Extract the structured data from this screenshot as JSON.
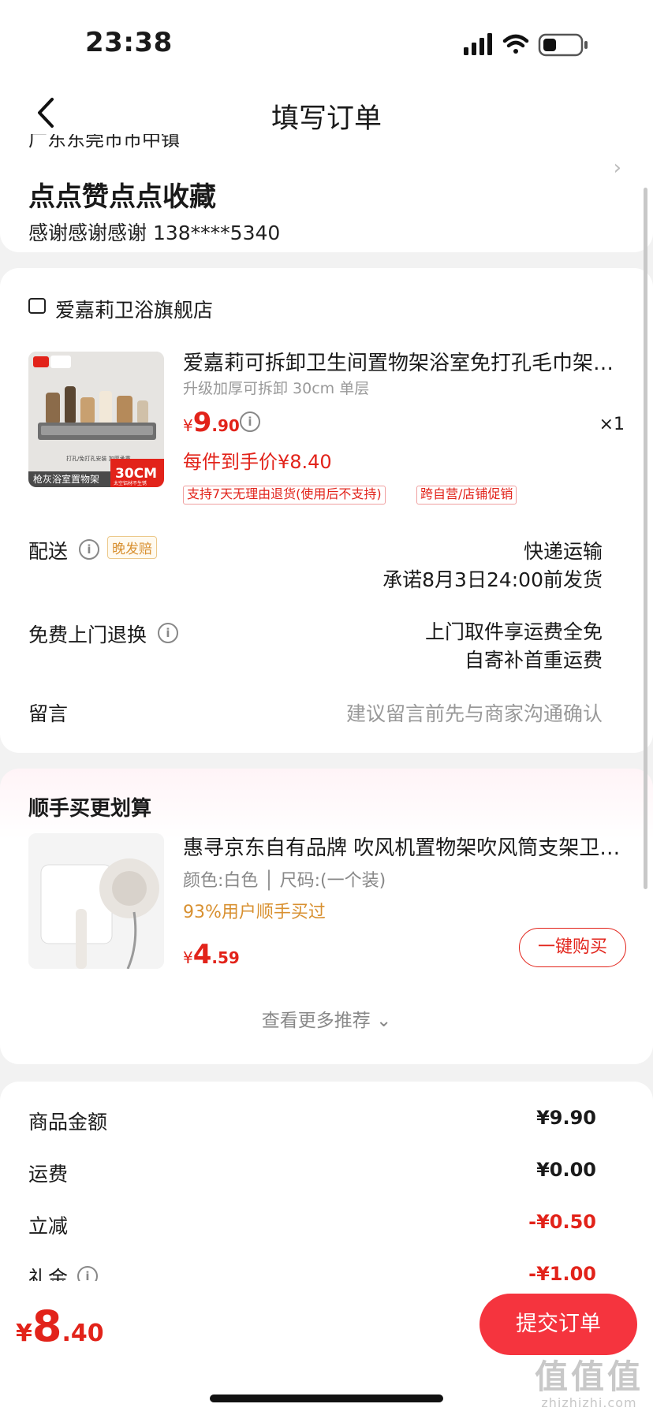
{
  "status": {
    "time": "23:38"
  },
  "nav": {
    "title": "填写订单"
  },
  "address": {
    "region": "广东东莞市市中镇",
    "name": "点点赞点点收藏",
    "contact": "感谢感谢感谢  138****5340",
    "arrow": "›"
  },
  "shop": {
    "name": "爱嘉莉卫浴旗舰店"
  },
  "product": {
    "title": "爱嘉莉可拆卸卫生间置物架浴室免打孔毛巾架厕所",
    "sku": "升级加厚可拆卸 30cm 单层",
    "price": {
      "currency": "¥",
      "int": "9",
      "dec": ".90"
    },
    "qty": "×1",
    "final_price": "每件到手价¥8.40",
    "tags": [
      "支持7天无理由退货(使用后不支持)",
      "跨自营/店铺促销"
    ],
    "image_text": {
      "top": "打孔/免打孔安装 加厚承重",
      "badge": "30CM",
      "badge_sub": "太空铝材不生锈",
      "bottom": "枪灰浴室置物架"
    }
  },
  "delivery": {
    "label": "配送",
    "badge": "晚发赔",
    "method": "快递运输",
    "promise": "承诺8月3日24:00前发货"
  },
  "return_service": {
    "label": "免费上门退换",
    "line1": "上门取件享运费全免",
    "line2": "自寄补首重运费"
  },
  "message": {
    "label": "留言",
    "placeholder": "建议留言前先与商家沟通确认"
  },
  "recommend": {
    "title": "顺手买更划算",
    "item": {
      "name": "惠寻京东自有品牌 吹风机置物架吹风筒支架卫生间",
      "spec": "颜色:白色 │ 尺码:(一个装)",
      "social": "93%用户顺手买过",
      "price": {
        "currency": "¥",
        "int": "4",
        "dec": ".59"
      },
      "button": "一键购买"
    },
    "more": "查看更多推荐 ⌄"
  },
  "summary": {
    "rows": [
      {
        "label": "商品金额",
        "value": "¥9.90"
      },
      {
        "label": "运费",
        "value": "¥0.00"
      },
      {
        "label": "立减",
        "value": "-¥0.50"
      },
      {
        "label": "礼金",
        "value": "-¥1.00"
      }
    ]
  },
  "bottom": {
    "total": {
      "currency": "¥",
      "int": "8",
      "dec": ".40"
    },
    "submit": "提交订单"
  },
  "watermark": {
    "main": "值值值",
    "sub": "zhizhizhi.com"
  },
  "colors": {
    "accent": "#e2231a",
    "button": "#f5343e",
    "promo": "#d89030"
  }
}
